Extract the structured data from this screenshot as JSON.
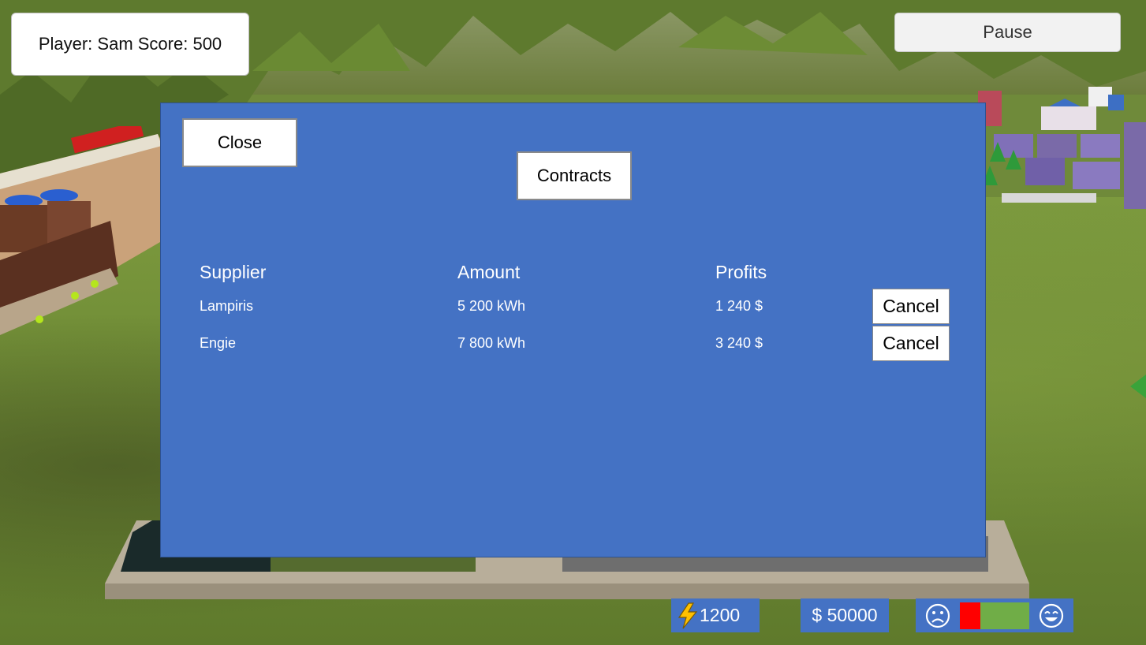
{
  "hud": {
    "player_text": "Player: Sam Score: 500",
    "pause_label": "Pause",
    "energy_value": "1200",
    "money_value": "$ 50000",
    "satisfaction": 0.3
  },
  "panel": {
    "close_label": "Close",
    "title": "Contracts",
    "columns": {
      "supplier": "Supplier",
      "amount": "Amount",
      "profits": "Profits"
    },
    "rows": [
      {
        "supplier": "Lampiris",
        "amount": "5 200 kWh",
        "profits": "1 240 $",
        "action": "Cancel"
      },
      {
        "supplier": "Engie",
        "amount": "7 800 kWh",
        "profits": "3 240 $",
        "action": "Cancel"
      }
    ]
  },
  "colors": {
    "panel": "#4472c4",
    "mood_bad": "#ff0000",
    "mood_good": "#70ad47"
  },
  "icons": {
    "energy": "lightning-icon",
    "mood_low": "sad-face-icon",
    "mood_high": "laughing-face-icon"
  }
}
